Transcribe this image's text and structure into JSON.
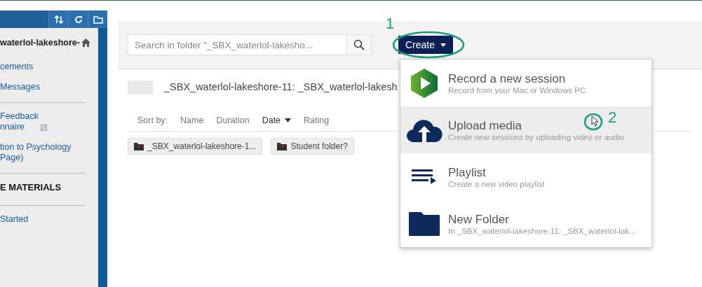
{
  "sidebar": {
    "course_title": "waterlol-lakeshore-",
    "sections": [
      {
        "items": [
          {
            "label": "cements"
          },
          {
            "label": "Messages"
          }
        ]
      },
      {
        "items": [
          {
            "label": "Feedback\nnnaire",
            "external": true
          },
          {
            "label": "tion to Psychology\nPage)"
          }
        ]
      },
      {
        "heading": "E MATERIALS"
      },
      {
        "items": [
          {
            "label": "Started"
          }
        ]
      }
    ]
  },
  "search": {
    "placeholder": "Search in folder \"_SBX_waterlol-lakesho..."
  },
  "create_button": {
    "label": "Create"
  },
  "folder_title": "_SBX_waterlol-lakeshore-11: _SBX_waterlol-lakesh",
  "sort": {
    "label": "Sort by:",
    "options": [
      {
        "label": "Name",
        "selected": false
      },
      {
        "label": "Duration",
        "selected": false
      },
      {
        "label": "Date",
        "selected": true
      },
      {
        "label": "Rating",
        "selected": false
      }
    ]
  },
  "folders": [
    {
      "label": "_SBX_waterlol-lakeshore-1..."
    },
    {
      "label": "Student folder?"
    }
  ],
  "menu": [
    {
      "kind": "record",
      "title": "Record a new session",
      "subtitle": "Record from your Mac or Windows PC",
      "selected": false
    },
    {
      "kind": "upload",
      "title": "Upload media",
      "subtitle": "Create new sessions by uploading video or audio",
      "selected": true
    },
    {
      "kind": "playlist",
      "title": "Playlist",
      "subtitle": "Create a new video playlist",
      "selected": false
    },
    {
      "kind": "folder",
      "title": "New Folder",
      "subtitle": "In _SBX_waterlol-lakeshore-11: _SBX_waterlol-lak...",
      "selected": false
    }
  ],
  "callouts": [
    {
      "label": "1"
    },
    {
      "label": "2"
    }
  ]
}
